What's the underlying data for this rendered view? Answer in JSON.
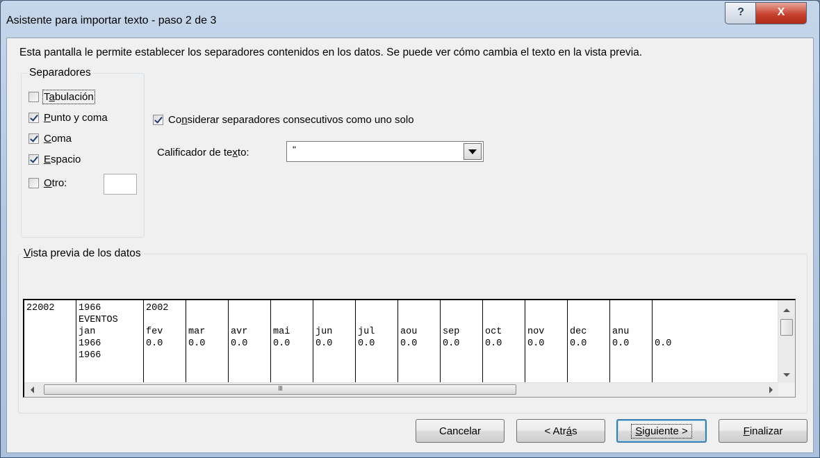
{
  "window": {
    "title": "Asistente para importar texto - paso 2 de 3",
    "help_glyph": "?",
    "close_glyph": "X"
  },
  "description": "Esta pantalla le permite establecer los separadores contenidos en los datos. Se puede ver cómo cambia el texto en la vista previa.",
  "separators": {
    "group_label": "Separadores",
    "tab": {
      "label": "Tabulación",
      "accel_before": "T",
      "accel": "a",
      "accel_after": "bulación",
      "checked": false
    },
    "semicolon": {
      "label": "Punto y coma",
      "accel": "P",
      "accel_after": "unto y coma",
      "checked": true
    },
    "comma": {
      "label": "Coma",
      "accel": "C",
      "accel_after": "oma",
      "checked": true
    },
    "space": {
      "label": "Espacio",
      "accel": "E",
      "accel_after": "spacio",
      "checked": true
    },
    "other": {
      "label": "Otro:",
      "accel": "O",
      "accel_after": "tro:",
      "checked": false,
      "value": ""
    }
  },
  "consecutive": {
    "label": "Considerar separadores consecutivos como uno solo",
    "before": "Co",
    "accel": "n",
    "after": "siderar separadores consecutivos como uno solo",
    "checked": true
  },
  "text_qualifier": {
    "label": "Calificador de texto:",
    "before": "Calificador de te",
    "accel": "x",
    "after": "to:",
    "value": "\""
  },
  "preview": {
    "group_label": "Vista previa de los datos",
    "accel": "V",
    "accel_after": "ista previa de los datos",
    "rows": [
      [
        "22002",
        "1966",
        "2002",
        "",
        "",
        "",
        "",
        "",
        "",
        "",
        "",
        "",
        "",
        "",
        ""
      ],
      [
        "",
        "EVENTOS",
        "",
        "",
        "",
        "",
        "",
        "",
        "",
        "",
        "",
        "",
        "",
        "",
        ""
      ],
      [
        "",
        "jan",
        "fev",
        "mar",
        "avr",
        "mai",
        "jun",
        "jul",
        "aou",
        "sep",
        "oct",
        "nov",
        "dec",
        "anu",
        ""
      ],
      [
        "",
        "1966",
        "0.0",
        "0.0",
        "0.0",
        "0.0",
        "0.0",
        "0.0",
        "0.0",
        "0.0",
        "0.0",
        "0.0",
        "0.0",
        "0.0",
        "0.0"
      ],
      [
        "",
        "1966",
        "",
        "",
        "",
        "",
        "",
        "",
        "",
        "",
        "",
        "",
        "",
        "",
        ""
      ]
    ],
    "hscroll_grip": "III"
  },
  "buttons": {
    "cancel": "Cancelar",
    "back": {
      "before": "< Atr",
      "accel": "á",
      "after": "s"
    },
    "next": {
      "accel": "S",
      "after": "iguiente >"
    },
    "finish": {
      "accel": "F",
      "after": "inalizar"
    }
  }
}
